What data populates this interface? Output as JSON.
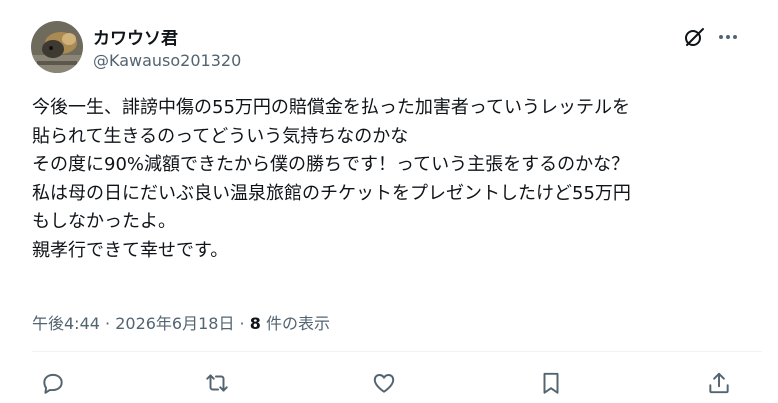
{
  "author": {
    "display_name": "カワウソ君",
    "handle": "@Kawauso201320"
  },
  "icons": {
    "grok": "grok-icon",
    "more": "more-icon",
    "reply": "reply-icon",
    "retweet": "retweet-icon",
    "like": "like-icon",
    "bookmark": "bookmark-icon",
    "share": "share-icon"
  },
  "tweet": {
    "lines": [
      "今後一生、誹謗中傷の55万円の賠償金を払った加害者っていうレッテルを",
      "貼られて生きるのってどういう気持ちなのかな",
      "その度に90%減額できたから僕の勝ちです！っていう主張をするのかな？",
      "私は母の日にだいぶ良い温泉旅館のチケットをプレゼントしたけど55万円",
      "もしなかったよ。",
      "親孝行できて幸せです。"
    ]
  },
  "meta": {
    "time": "午後4:44",
    "separator": " · ",
    "date": "2026年6月18日",
    "views_count": "8",
    "views_label": "件の表示"
  },
  "colors": {
    "text": "#0f1419",
    "secondary": "#536471",
    "divider": "#eff3f4"
  }
}
